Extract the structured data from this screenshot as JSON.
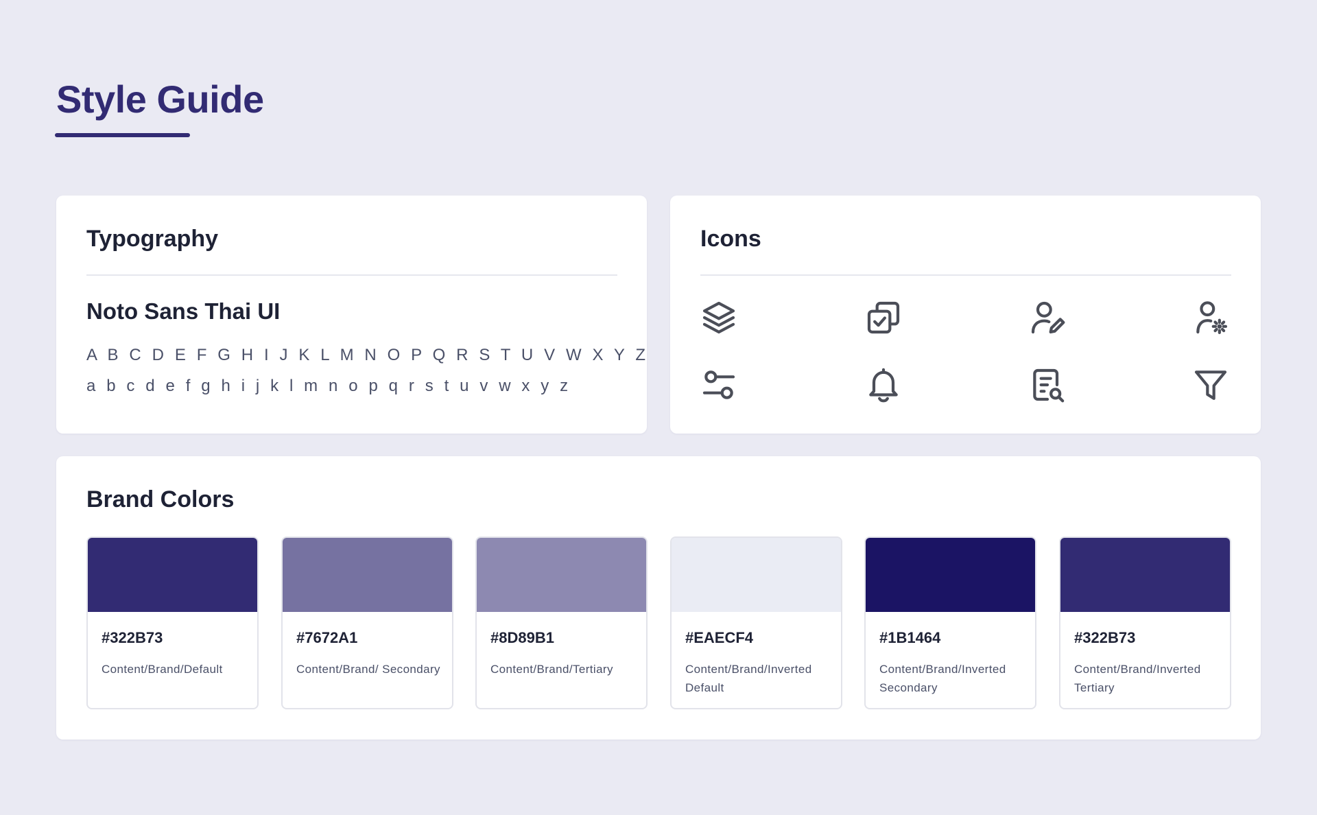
{
  "page": {
    "title": "Style Guide",
    "accent_color": "#322B73",
    "background_color": "#EAEAF3"
  },
  "typography": {
    "title": "Typography",
    "font_name": "Noto Sans Thai UI",
    "uppercase": "A B C D E F G H I J K L M N O P Q R S T U V W X Y Z",
    "lowercase": "a b c d e f g h i j k l m n o p q r s t u v w x y z"
  },
  "icons": {
    "title": "Icons",
    "items": [
      {
        "name": "layers-icon"
      },
      {
        "name": "copy-check-icon"
      },
      {
        "name": "user-edit-icon"
      },
      {
        "name": "user-settings-icon"
      },
      {
        "name": "sliders-icon"
      },
      {
        "name": "bell-icon"
      },
      {
        "name": "document-search-icon"
      },
      {
        "name": "filter-icon"
      }
    ]
  },
  "brand_colors": {
    "title": "Brand Colors",
    "swatches": [
      {
        "hex": "#322B73",
        "label": "Content/Brand/Default",
        "color": "#322B73"
      },
      {
        "hex": "#7672A1",
        "label": "Content/Brand/ Secondary",
        "color": "#7672A1"
      },
      {
        "hex": "#8D89B1",
        "label": "Content/Brand/Tertiary",
        "color": "#8D89B1"
      },
      {
        "hex": "#EAECF4",
        "label": "Content/Brand/Inverted Default",
        "color": "#EAECF4"
      },
      {
        "hex": "#1B1464",
        "label": "Content/Brand/Inverted Secondary",
        "color": "#1B1464"
      },
      {
        "hex": "#322B73",
        "label": "Content/Brand/Inverted Tertiary",
        "color": "#322B73"
      }
    ]
  }
}
